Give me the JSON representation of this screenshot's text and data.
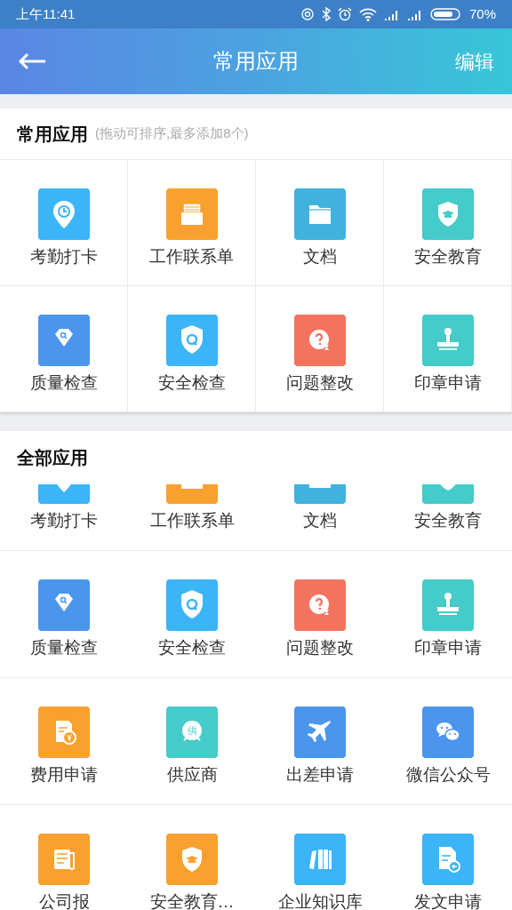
{
  "status_bar": {
    "time": "上午11:41",
    "battery": "70%"
  },
  "header": {
    "title": "常用应用",
    "action": "编辑"
  },
  "favorites": {
    "title": "常用应用",
    "hint": "(拖动可排序,最多添加8个)",
    "apps": [
      {
        "label": "考勤打卡",
        "kind": "attendance",
        "color": "#3cb4f8"
      },
      {
        "label": "工作联系单",
        "kind": "tray",
        "color": "#f9a12e"
      },
      {
        "label": "文档",
        "kind": "folder",
        "color": "#41b1dd"
      },
      {
        "label": "安全教育",
        "kind": "shield-cap",
        "color": "#45cbc9"
      },
      {
        "label": "质量检查",
        "kind": "gem-search",
        "color": "#4b96ec"
      },
      {
        "label": "安全检查",
        "kind": "shield-q",
        "color": "#3cb4f8"
      },
      {
        "label": "问题整改",
        "kind": "question",
        "color": "#f4735f"
      },
      {
        "label": "印章申请",
        "kind": "stamp",
        "color": "#45cbc9"
      }
    ]
  },
  "all_apps": {
    "title": "全部应用",
    "rows": [
      [
        {
          "label": "考勤打卡",
          "kind": "attendance",
          "color": "#3cb4f8"
        },
        {
          "label": "工作联系单",
          "kind": "tray",
          "color": "#f9a12e"
        },
        {
          "label": "文档",
          "kind": "folder",
          "color": "#41b1dd"
        },
        {
          "label": "安全教育",
          "kind": "shield-cap",
          "color": "#45cbc9"
        }
      ],
      [
        {
          "label": "质量检查",
          "kind": "gem-search",
          "color": "#4b96ec"
        },
        {
          "label": "安全检查",
          "kind": "shield-q",
          "color": "#3cb4f8"
        },
        {
          "label": "问题整改",
          "kind": "question",
          "color": "#f4735f"
        },
        {
          "label": "印章申请",
          "kind": "stamp",
          "color": "#45cbc9"
        }
      ],
      [
        {
          "label": "费用申请",
          "kind": "expense",
          "color": "#f9a12e"
        },
        {
          "label": "供应商",
          "kind": "badge-char",
          "color": "#45cbc9",
          "icon_text": "供"
        },
        {
          "label": "出差申请",
          "kind": "plane",
          "color": "#4b96ec"
        },
        {
          "label": "微信公众号",
          "kind": "chat",
          "color": "#4b96ec"
        }
      ],
      [
        {
          "label": "公司报",
          "kind": "newspaper",
          "color": "#f9a12e"
        },
        {
          "label": "安全教育…",
          "kind": "shield-cap",
          "color": "#f9a12e"
        },
        {
          "label": "企业知识库",
          "kind": "books",
          "color": "#3cb4f8"
        },
        {
          "label": "发文申请",
          "kind": "doc-arrow",
          "color": "#3cb4f8"
        }
      ]
    ]
  }
}
